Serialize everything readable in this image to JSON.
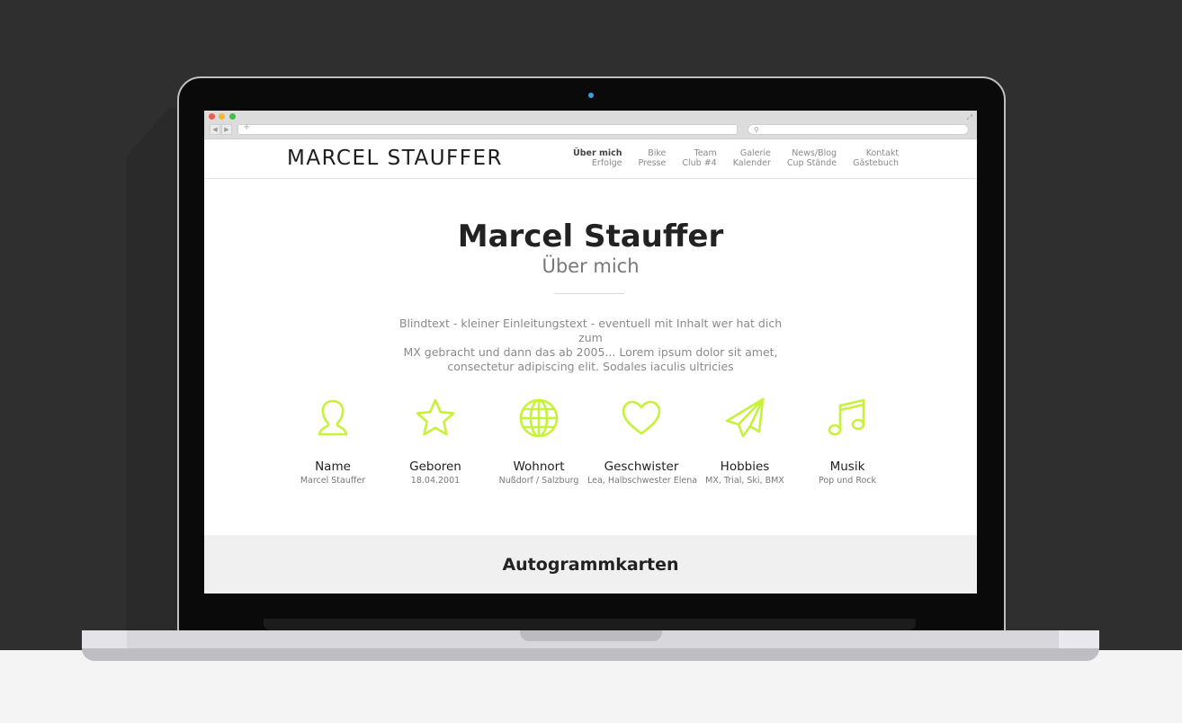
{
  "site": {
    "logo": "MARCEL STAUFFER"
  },
  "nav": [
    {
      "top": "Über mich",
      "bottom": "Erfolge",
      "active": true
    },
    {
      "top": "Bike",
      "bottom": "Presse"
    },
    {
      "top": "Team",
      "bottom": "Club #4"
    },
    {
      "top": "Galerie",
      "bottom": "Kalender"
    },
    {
      "top": "News/Blog",
      "bottom": "Cup Stände"
    },
    {
      "top": "Kontakt",
      "bottom": "Gästebuch"
    }
  ],
  "hero": {
    "title": "Marcel Stauffer",
    "subtitle": "Über mich",
    "intro_lines": [
      "Blindtext - kleiner Einleitungstext - eventuell mit Inhalt wer hat dich zum",
      "MX gebracht und dann das ab 2005... Lorem ipsum dolor sit amet,",
      "consectetur adipiscing elit. Sodales iaculis ultricies"
    ]
  },
  "facts": [
    {
      "icon": "person-icon",
      "label": "Name",
      "value": "Marcel Stauffer"
    },
    {
      "icon": "star-icon",
      "label": "Geboren",
      "value": "18.04.2001"
    },
    {
      "icon": "globe-icon",
      "label": "Wohnort",
      "value": "Nußdorf / Salzburg"
    },
    {
      "icon": "heart-icon",
      "label": "Geschwister",
      "value": "Lea, Halbschwester Elena"
    },
    {
      "icon": "paper-plane-icon",
      "label": "Hobbies",
      "value": "MX, Trial, Ski, BMX"
    },
    {
      "icon": "music-note-icon",
      "label": "Musik",
      "value": "Pop und Rock"
    }
  ],
  "section": {
    "title": "Autogrammkarten"
  },
  "colors": {
    "accent": "#c6f23a",
    "text": "#222222",
    "muted": "#8a8a8a",
    "band": "#f0f0f0"
  }
}
